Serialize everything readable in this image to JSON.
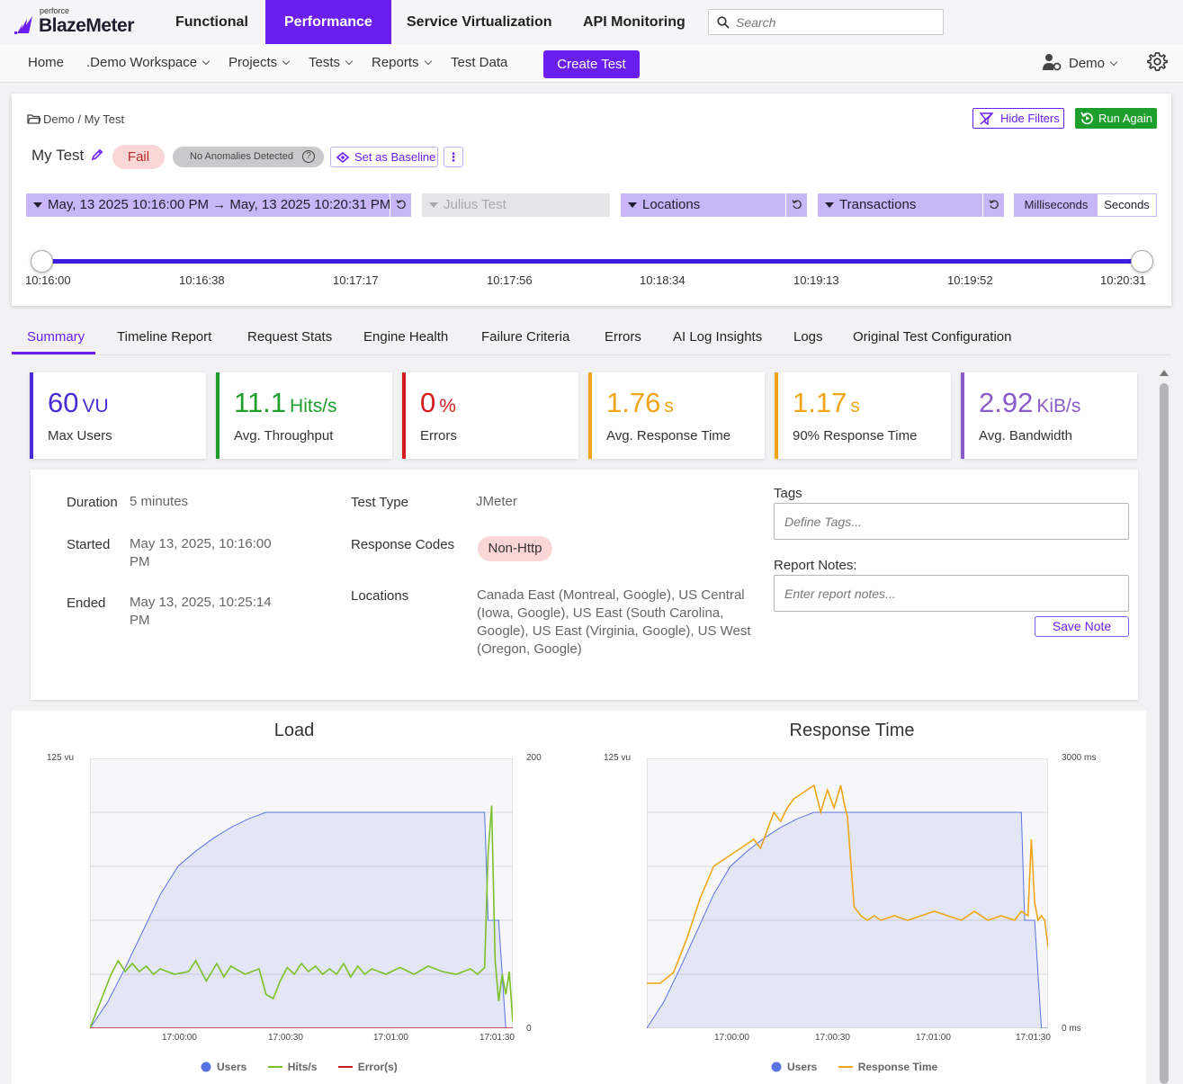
{
  "brand": {
    "company": "perforce",
    "product": "BlazeMeter"
  },
  "top_nav": [
    {
      "label": "Functional",
      "active": false
    },
    {
      "label": "Performance",
      "active": true
    },
    {
      "label": "Service Virtualization",
      "active": false
    },
    {
      "label": "API Monitoring",
      "active": false
    }
  ],
  "search": {
    "placeholder": "Search"
  },
  "secondary_nav": {
    "home": "Home",
    "workspace": ".Demo Workspace",
    "projects": "Projects",
    "tests": "Tests",
    "reports": "Reports",
    "test_data": "Test Data",
    "create_test": "Create Test",
    "user": "Demo"
  },
  "header": {
    "breadcrumb_root": "Demo",
    "breadcrumb_sep": "/",
    "breadcrumb_leaf": "My Test",
    "hide_filters": "Hide Filters",
    "run_again": "Run Again",
    "test_name": "My Test",
    "status": "Fail",
    "anomalies": "No Anomalies Detected",
    "set_baseline": "Set as Baseline",
    "date_range": "May, 13 2025 10:16:00 PM → May, 13 2025 10:20:31 PM",
    "scenario": "Julius Test",
    "locations": "Locations",
    "transactions": "Transactions",
    "unit_ms": "Milliseconds",
    "unit_s": "Seconds",
    "timeline_ticks": [
      "10:16:00",
      "10:16:38",
      "10:17:17",
      "10:17:56",
      "10:18:34",
      "10:19:13",
      "10:19:52",
      "10:20:31"
    ]
  },
  "tabs": [
    "Summary",
    "Timeline Report",
    "Request Stats",
    "Engine Health",
    "Failure Criteria",
    "Errors",
    "AI Log Insights",
    "Logs",
    "Original Test Configuration"
  ],
  "kpis": [
    {
      "value": "60",
      "unit": "VU",
      "label": "Max Users",
      "color": "#4b2bd6"
    },
    {
      "value": "11.1",
      "unit": "Hits/s",
      "label": "Avg. Throughput",
      "color": "#1e9e2c"
    },
    {
      "value": "0",
      "unit": "%",
      "label": "Errors",
      "color": "#d41c1c"
    },
    {
      "value": "1.76",
      "unit": "s",
      "label": "Avg. Response Time",
      "color": "#f0a519"
    },
    {
      "value": "1.17",
      "unit": "s",
      "label": "90% Response Time",
      "color": "#f0a519"
    },
    {
      "value": "2.92",
      "unit": "KiB/s",
      "label": "Avg. Bandwidth",
      "color": "#8a5cc9"
    }
  ],
  "details": {
    "duration_label": "Duration",
    "duration": "5 minutes",
    "started_label": "Started",
    "started_l1": "May 13, 2025, 10:16:00",
    "started_l2": "PM",
    "ended_label": "Ended",
    "ended_l1": "May 13, 2025, 10:25:14",
    "ended_l2": "PM",
    "test_type_label": "Test Type",
    "test_type": "JMeter",
    "response_codes_label": "Response Codes",
    "response_code": "Non-Http",
    "locations_label": "Locations",
    "locations_lines": [
      "Canada East (Montreal, Google), US Central",
      "(Iowa, Google), US East (South Carolina,",
      "Google), US East (Virginia, Google), US West",
      "(Oregon, Google)"
    ],
    "tags_label": "Tags",
    "tags_placeholder": "Define Tags...",
    "notes_label": "Report Notes:",
    "notes_placeholder": "Enter report notes...",
    "save_note": "Save Note"
  },
  "chart_data": [
    {
      "type": "line",
      "title": "Load",
      "x_ticks": [
        "17:00:00",
        "17:00:30",
        "17:01:00",
        "17:01:30"
      ],
      "y_left_label": "125 vu",
      "y_left_range": [
        0,
        125
      ],
      "y_right_top": "200",
      "y_right_bottom": "0",
      "y_right_range": [
        0,
        200
      ],
      "x_range_s": [
        0,
        120
      ],
      "legend": [
        "Users",
        "Hits/s",
        "Error(s)"
      ],
      "colors": {
        "Users": "#5b73e0",
        "Hits/s": "#7cc02a",
        "Error(s)": "#c81e2e"
      },
      "series": [
        {
          "name": "Users",
          "axis": "left",
          "x": [
            0,
            5,
            10,
            15,
            20,
            25,
            30,
            35,
            40,
            45,
            50,
            55,
            60,
            80,
            100,
            110,
            112,
            113,
            116,
            118,
            120
          ],
          "y": [
            0,
            12,
            28,
            45,
            62,
            75,
            82,
            88,
            93,
            97,
            100,
            100,
            100,
            100,
            100,
            100,
            100,
            50,
            50,
            0,
            0
          ]
        },
        {
          "name": "Hits/s",
          "axis": "right",
          "x": [
            0,
            3,
            6,
            8,
            10,
            12,
            14,
            16,
            18,
            20,
            24,
            28,
            30,
            33,
            36,
            38,
            40,
            44,
            48,
            50,
            52,
            54,
            56,
            58,
            60,
            62,
            64,
            66,
            68,
            70,
            72,
            74,
            76,
            78,
            80,
            84,
            88,
            92,
            96,
            100,
            104,
            108,
            110,
            112,
            113,
            114,
            115,
            116,
            117,
            118,
            119,
            120
          ],
          "y": [
            0,
            20,
            40,
            50,
            42,
            48,
            42,
            46,
            40,
            44,
            40,
            42,
            50,
            35,
            48,
            38,
            46,
            40,
            44,
            25,
            22,
            35,
            45,
            40,
            48,
            42,
            46,
            40,
            44,
            40,
            48,
            38,
            46,
            40,
            44,
            40,
            45,
            40,
            46,
            42,
            40,
            44,
            40,
            45,
            130,
            165,
            50,
            20,
            40,
            25,
            42,
            5
          ]
        },
        {
          "name": "Error(s)",
          "axis": "right",
          "x": [
            0,
            120
          ],
          "y": [
            0,
            0
          ]
        }
      ]
    },
    {
      "type": "line",
      "title": "Response Time",
      "x_ticks": [
        "17:00:00",
        "17:00:30",
        "17:01:00",
        "17:01:30"
      ],
      "y_left_label": "125 vu",
      "y_left_range": [
        0,
        125
      ],
      "y_right_top": "3000 ms",
      "y_right_bottom": "0 ms",
      "y_right_range": [
        0,
        3000
      ],
      "x_range_s": [
        0,
        120
      ],
      "legend": [
        "Users",
        "Response Time"
      ],
      "colors": {
        "Users": "#5b73e0",
        "Response Time": "#f0a519"
      },
      "series": [
        {
          "name": "Users",
          "axis": "left",
          "x": [
            0,
            5,
            10,
            15,
            20,
            25,
            30,
            35,
            40,
            45,
            50,
            55,
            60,
            80,
            100,
            110,
            112,
            113,
            116,
            118,
            120
          ],
          "y": [
            0,
            12,
            28,
            45,
            62,
            75,
            82,
            88,
            93,
            97,
            100,
            100,
            100,
            100,
            100,
            100,
            100,
            50,
            50,
            0,
            0
          ]
        },
        {
          "name": "Response Time",
          "axis": "right",
          "x": [
            0,
            4,
            8,
            12,
            16,
            20,
            24,
            28,
            32,
            34,
            36,
            38,
            40,
            42,
            44,
            46,
            48,
            50,
            52,
            54,
            56,
            58,
            59,
            60,
            62,
            64,
            66,
            68,
            70,
            74,
            78,
            82,
            86,
            90,
            94,
            98,
            102,
            106,
            110,
            112,
            114,
            115,
            116,
            117,
            118,
            119,
            120
          ],
          "y": [
            500,
            500,
            620,
            1000,
            1450,
            1800,
            1900,
            2000,
            2100,
            2000,
            2200,
            2400,
            2300,
            2450,
            2550,
            2600,
            2650,
            2700,
            2400,
            2650,
            2450,
            2700,
            2500,
            2350,
            1350,
            1250,
            1200,
            1250,
            1200,
            1250,
            1200,
            1250,
            1300,
            1250,
            1200,
            1300,
            1200,
            1250,
            1200,
            1300,
            1250,
            2100,
            1400,
            1200,
            1250,
            1200,
            900
          ]
        }
      ]
    }
  ]
}
